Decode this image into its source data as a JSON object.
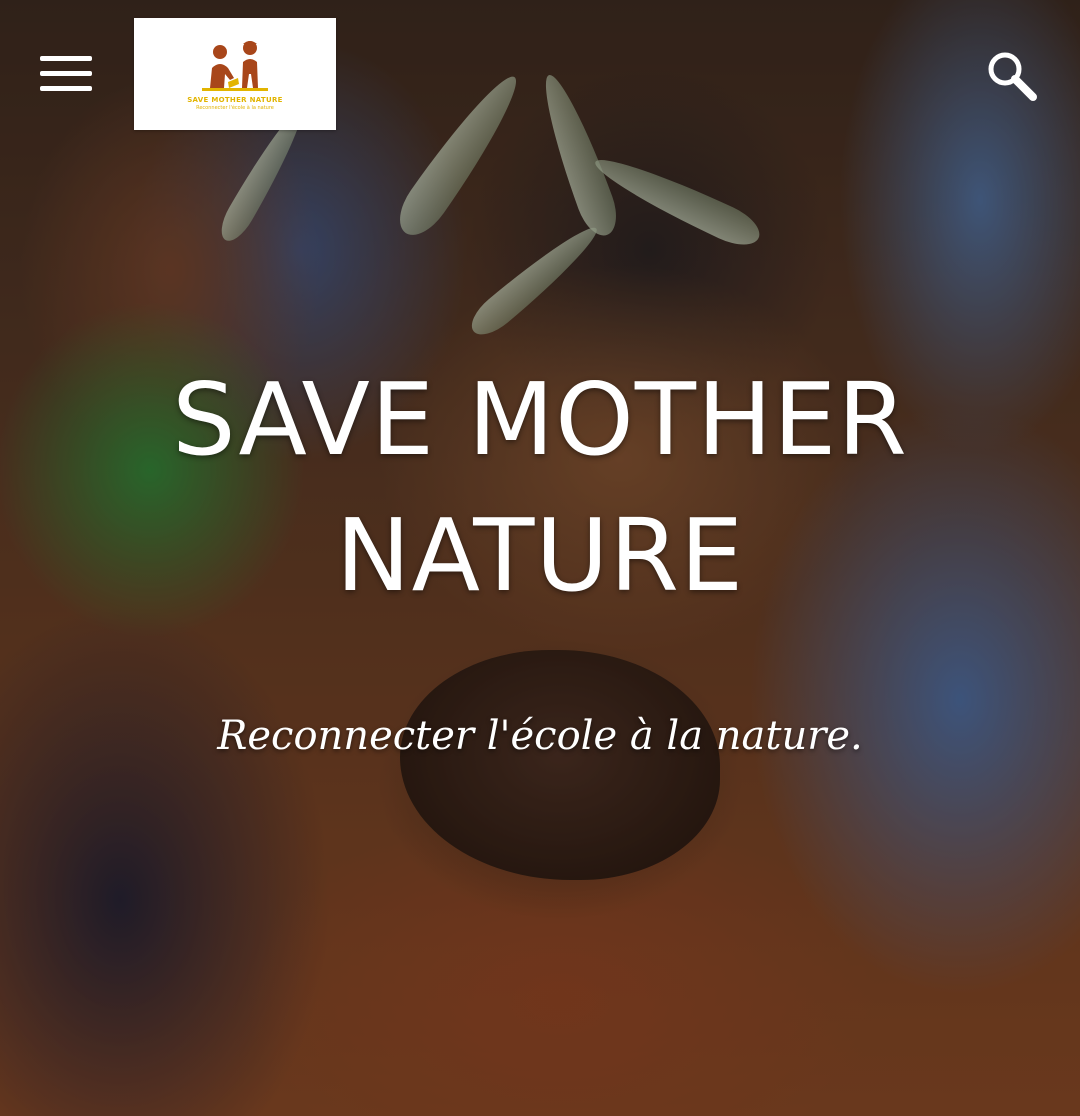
{
  "header": {
    "menu_icon": "hamburger-menu-icon",
    "search_icon": "search-icon",
    "logo": {
      "name": "SAVE MOTHER NATURE",
      "tagline": "Reconnecter l'école à la nature"
    }
  },
  "hero": {
    "title_line1": "SAVE MOTHER",
    "title_line2": "NATURE",
    "subtitle": "Reconnecter l'école à la nature."
  },
  "colors": {
    "text": "#ffffff",
    "logo_background": "#ffffff",
    "logo_accent": "#e2b400",
    "logo_figures": "#a8461a"
  }
}
